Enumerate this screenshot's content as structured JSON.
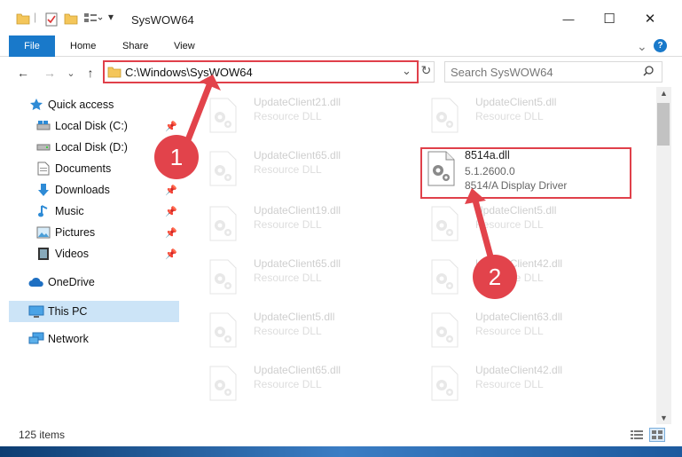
{
  "window": {
    "title": "SysWOW64",
    "minimize_label": "—",
    "maximize_label": "☐",
    "close_label": "✕"
  },
  "ribbon": {
    "tabs": [
      "File",
      "Home",
      "Share",
      "View"
    ],
    "help_label": "?",
    "expand_label": "⌄"
  },
  "navigation": {
    "back_label": "←",
    "forward_label": "→",
    "dropdown_label": "⌄",
    "up_label": "↑"
  },
  "address": {
    "path": "C:\\Windows\\SysWOW64",
    "dropdown_label": "⌄",
    "refresh_label": "↻"
  },
  "search": {
    "placeholder": "Search SysWOW64"
  },
  "sidebar": {
    "items": [
      {
        "label": "Quick access",
        "icon": "star-icon"
      },
      {
        "label": "Local Disk (C:)",
        "icon": "drive-icon"
      },
      {
        "label": "Local Disk (D:)",
        "icon": "drive-icon"
      },
      {
        "label": "Documents",
        "icon": "documents-icon"
      },
      {
        "label": "Downloads",
        "icon": "download-icon"
      },
      {
        "label": "Music",
        "icon": "music-icon"
      },
      {
        "label": "Pictures",
        "icon": "pictures-icon"
      },
      {
        "label": "Videos",
        "icon": "videos-icon"
      },
      {
        "label": "OneDrive",
        "icon": "cloud-icon"
      },
      {
        "label": "This PC",
        "icon": "computer-icon"
      },
      {
        "label": "Network",
        "icon": "network-icon"
      }
    ],
    "pin_label": "📌"
  },
  "files": [
    {
      "name": "UpdateClient21.dll",
      "desc": "Resource DLL"
    },
    {
      "name": "UpdateClient5.dll",
      "desc": "Resource DLL"
    },
    {
      "name": "UpdateClient65.dll",
      "desc": "Resource DLL"
    },
    {
      "name": "8514a.dll",
      "version": "5.1.2600.0",
      "desc": "8514/A Display Driver"
    },
    {
      "name": "UpdateClient19.dll",
      "desc": "Resource DLL"
    },
    {
      "name": "UpdateClient5.dll",
      "desc": "Resource DLL"
    },
    {
      "name": "UpdateClient65.dll",
      "desc": "Resource DLL"
    },
    {
      "name": "UpdateClient42.dll",
      "desc": "Resource DLL"
    },
    {
      "name": "UpdateClient5.dll",
      "desc": "Resource DLL"
    },
    {
      "name": "UpdateClient63.dll",
      "desc": "Resource DLL"
    },
    {
      "name": "UpdateClient65.dll",
      "desc": "Resource DLL"
    },
    {
      "name": "UpdateClient42.dll",
      "desc": "Resource DLL"
    }
  ],
  "status": {
    "item_count": "125 items"
  },
  "callouts": {
    "one": "1",
    "two": "2"
  },
  "colors": {
    "accent": "#1979ca",
    "highlight": "#e0404a",
    "callout": "#e2434b",
    "selection": "#cce4f7"
  }
}
